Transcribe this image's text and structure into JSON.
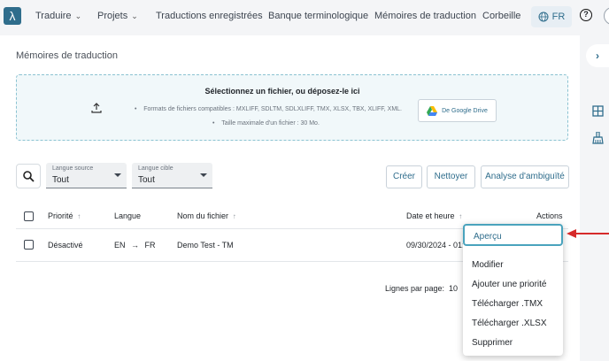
{
  "nav": {
    "logo": "λ",
    "items": [
      {
        "label": "Traduire",
        "has_menu": true
      },
      {
        "label": "Projets",
        "has_menu": true
      },
      {
        "label": "Traductions enregistrées",
        "has_menu": false
      },
      {
        "label": "Banque terminologique",
        "has_menu": false
      },
      {
        "label": "Mémoires de traduction",
        "has_menu": false
      },
      {
        "label": "Corbeille",
        "has_menu": false
      }
    ],
    "language": "FR",
    "help": "?"
  },
  "page": {
    "title": "Mémoires de traduction"
  },
  "dropzone": {
    "title": "Sélectionnez un fichier, ou déposez-le ici",
    "formats": "Formats de fichiers compatibles : MXLIFF, SDLTM, SDLXLIFF, TMX, XLSX, TBX, XLIFF, XML.",
    "max_size": "Taille maximale d'un fichier : 30 Mo.",
    "gdrive_label": "De Google Drive"
  },
  "filters": {
    "source": {
      "label": "Langue source",
      "value": "Tout"
    },
    "target": {
      "label": "Langue cible",
      "value": "Tout"
    }
  },
  "actions": {
    "create": "Créer",
    "clean": "Nettoyer",
    "ambiguity": "Analyse d'ambiguïté"
  },
  "table": {
    "headers": {
      "priority": "Priorité",
      "language": "Langue",
      "filename": "Nom du fichier",
      "datetime": "Date et heure",
      "actions": "Actions"
    },
    "rows": [
      {
        "priority": "Désactivé",
        "source_lang": "EN",
        "arrow": "→",
        "target_lang": "FR",
        "filename": "Demo Test - TM",
        "datetime": "09/30/2024 - 01:"
      }
    ]
  },
  "pagination": {
    "rows_label": "Lignes par page:",
    "rows_value": "10"
  },
  "menu": {
    "items": [
      "Aperçu",
      "Modifier",
      "Ajouter une priorité",
      "Télécharger .TMX",
      "Télécharger .XLSX",
      "Supprimer"
    ]
  },
  "colors": {
    "brand": "#2f6d8c",
    "highlight": "#4aa3bd",
    "annotation_arrow": "#d62a2a"
  }
}
